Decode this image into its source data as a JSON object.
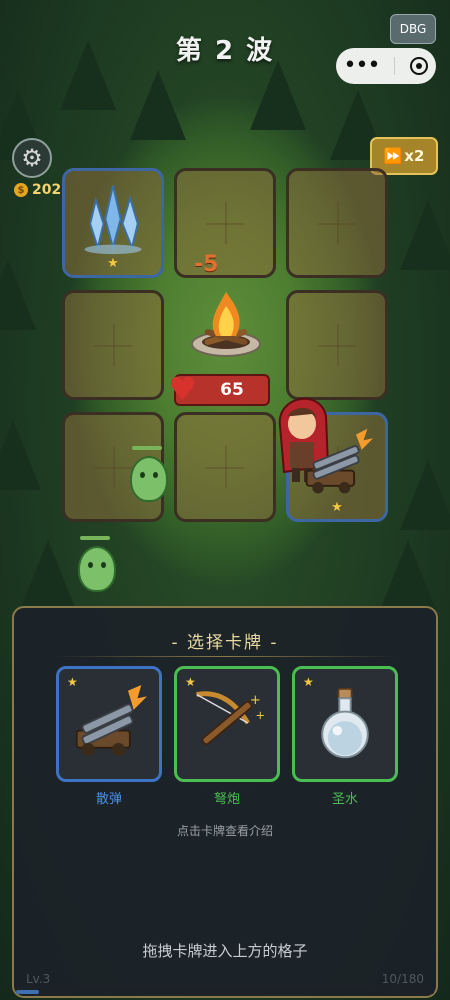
{
  "header": {
    "title": "第 2 波"
  },
  "debug_label": "DBG",
  "capsule": {
    "more_icon": "more-icon",
    "close_icon": "target-icon"
  },
  "hud": {
    "coins": "202",
    "speed_label": "x2"
  },
  "battle": {
    "damage_text": "-5",
    "base_hp": "65",
    "grid": {
      "rows": 3,
      "cols": 3,
      "cells": [
        {
          "card": "ice-crystal",
          "stars": "★",
          "border": "#3e66a3"
        },
        {
          "card": null
        },
        {
          "card": null
        },
        {
          "card": null
        },
        {
          "card": "campfire"
        },
        {
          "card": null
        },
        {
          "card": null
        },
        {
          "card": null
        },
        {
          "card": "scatter-cannon",
          "stars": "★",
          "border": "#3e66a3"
        }
      ]
    }
  },
  "card_panel": {
    "title": "- 选择卡牌 -",
    "cards": [
      {
        "name": "散弹",
        "stars": "★",
        "color": "#4a90e2",
        "icon": "cannon-icon"
      },
      {
        "name": "弩炮",
        "stars": "★",
        "color": "#4bbd53",
        "icon": "crossbow-icon"
      },
      {
        "name": "圣水",
        "stars": "★",
        "color": "#4bbd53",
        "icon": "holy-water-icon"
      }
    ],
    "hint_tap": "点击卡牌查看介绍",
    "hint_drag": "拖拽卡牌进入上方的格子",
    "level": "Lv.3",
    "exp_text": "10/180",
    "exp_fraction": 0.056
  }
}
